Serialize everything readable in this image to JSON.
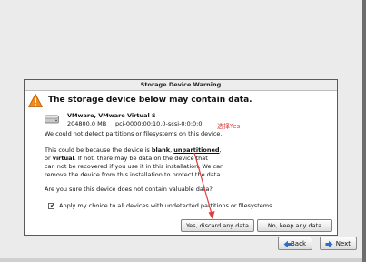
{
  "dialog": {
    "title": "Storage Device Warning",
    "heading": "The storage device below may contain data.",
    "device": {
      "name": "VMware, VMware Virtual S",
      "size": "204800.0 MB",
      "path": "pci-0000:00:10.0-scsi-0:0:0:0"
    },
    "p1": "We could not detect partitions or filesystems on this device.",
    "p2": {
      "line1_a": "This could be because the device is ",
      "line1_blank": "blank",
      "line1_comma": ", ",
      "line1_unpartitioned": "unpartitioned",
      "line1_end": ",",
      "line2_a": "or ",
      "line2_virtual": "virtual",
      "line2_b": ". If not, there may be data on the device that",
      "line3": "can not be recovered if you use it in this installation. We can",
      "line4": "remove the device from this installation to protect the data."
    },
    "p3": "Are you sure this device does not contain valuable data?",
    "checkbox_label": "Apply my choice to all devices with undetected partitions or filesystems",
    "checkbox_checked": true,
    "yes_button": "Yes, discard any data",
    "no_button": "No, keep any data"
  },
  "annotation": {
    "text": "选择Yes",
    "color": "#e23b3b"
  },
  "nav": {
    "back_label": "Back",
    "next_label": "Next"
  },
  "icons": {
    "warning": "warning-triangle-icon",
    "disk": "hard-disk-icon",
    "back": "back-arrow-icon",
    "next": "next-arrow-icon"
  }
}
